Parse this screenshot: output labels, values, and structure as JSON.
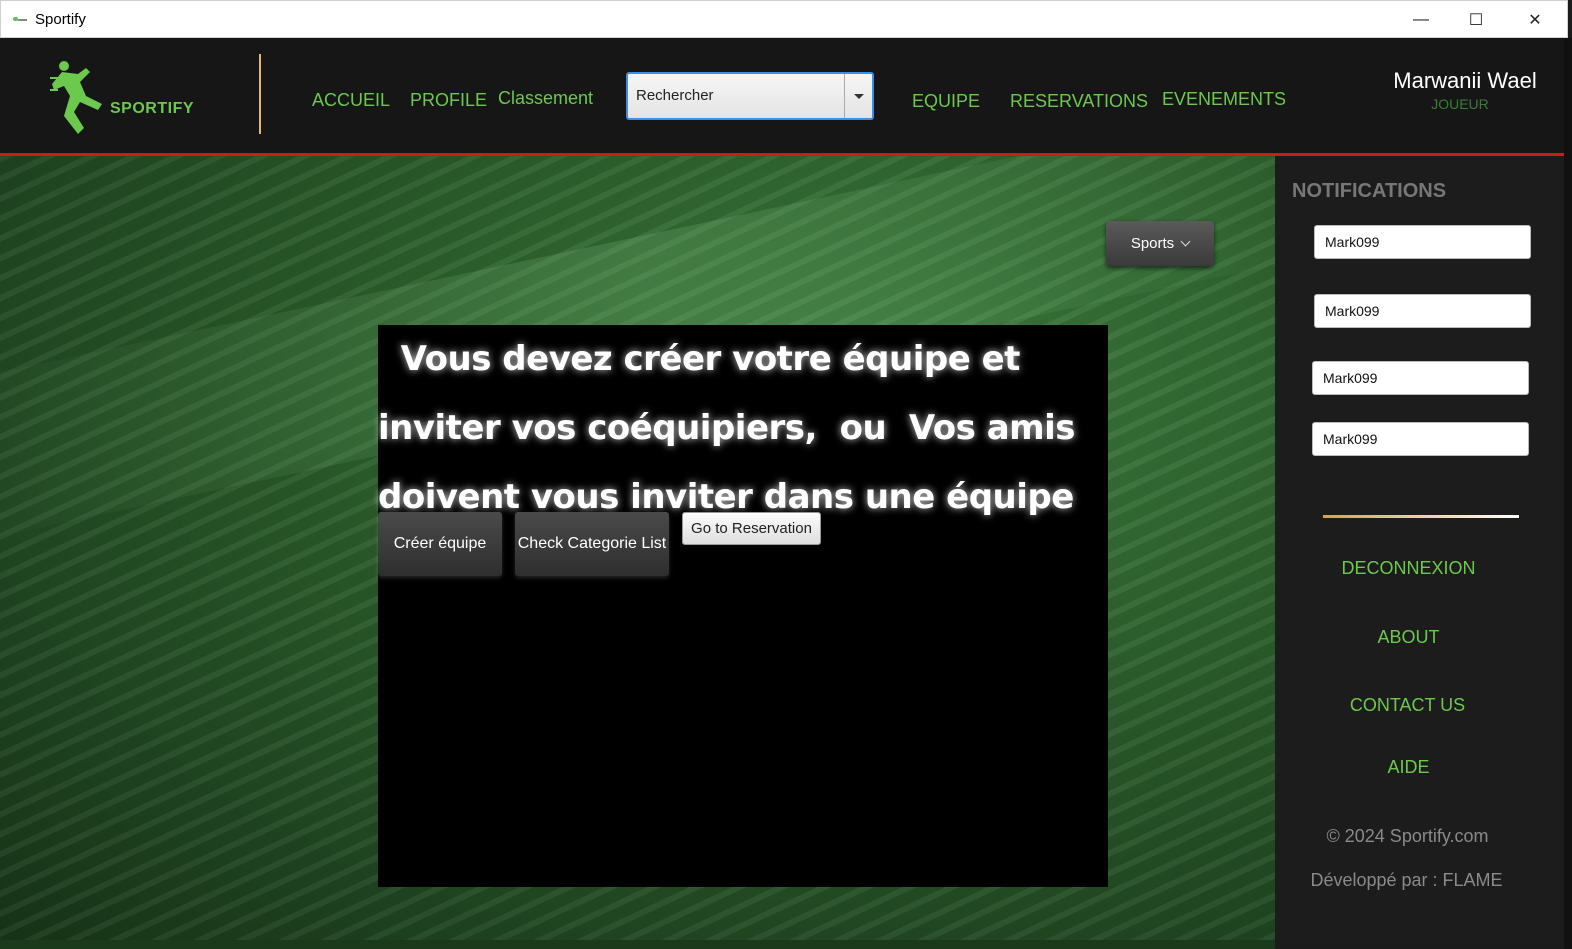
{
  "window": {
    "title": "Sportify",
    "minimize": "—",
    "maximize": "☐",
    "close": "✕"
  },
  "header": {
    "logo_text": "SPORTIFY",
    "nav": {
      "accueil": "ACCUEIL",
      "profile": "PROFILE",
      "classement": "Classement",
      "equipe": "EQUIPE",
      "reservations": "RESERVATIONS",
      "evenements": "EVENEMENTS"
    },
    "search": {
      "value": "Rechercher"
    },
    "user": {
      "name": "Marwanii Wael",
      "role": "JOUEUR"
    }
  },
  "main": {
    "sports_button": "Sports",
    "message_lines": [
      "  Vous devez créer votre équipe et",
      "inviter vos coéquipiers,  ou  Vos amis",
      "doivent vous inviter dans une équipe"
    ],
    "buttons": {
      "create_team": "Créer équipe",
      "check_category": "Check Categorie List",
      "go_reservation": "Go to Reservation"
    }
  },
  "sidebar": {
    "notifications_title": "NOTIFICATIONS",
    "notifications": [
      "Mark099",
      "Mark099",
      "Mark099",
      "Mark099"
    ],
    "links": {
      "logout": "DECONNEXION",
      "about": "ABOUT",
      "contact": "CONTACT US",
      "help": "AIDE"
    },
    "copyright": "© 2024 Sportify.com",
    "developer": "Développé par :  FLAME"
  },
  "colors": {
    "accent_green": "#6cc94d",
    "header_bg": "#161616",
    "divider_red": "#c91c1c"
  }
}
